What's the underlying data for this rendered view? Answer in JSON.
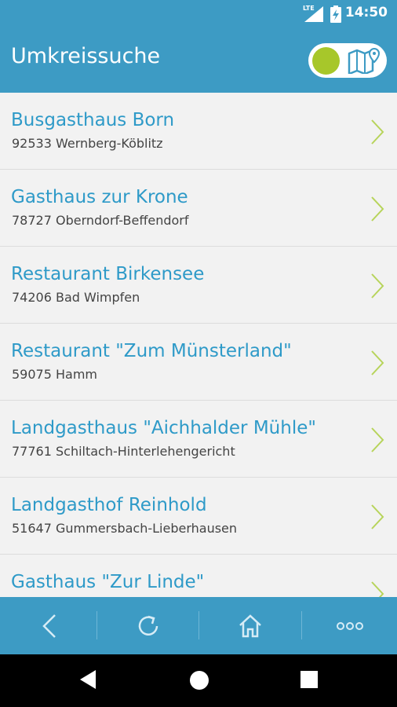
{
  "status_bar": {
    "time": "14:50",
    "network": "LTE"
  },
  "app_bar": {
    "title": "Umkreissuche",
    "view_toggle_icon": "map-icon"
  },
  "results": [
    {
      "name": "Busgasthaus Born",
      "address": "92533 Wernberg-Köblitz"
    },
    {
      "name": "Gasthaus zur Krone",
      "address": "78727 Oberndorf-Beffendorf"
    },
    {
      "name": "Restaurant Birkensee",
      "address": "74206 Bad Wimpfen"
    },
    {
      "name": "Restaurant \"Zum Münsterland\"",
      "address": "59075 Hamm"
    },
    {
      "name": "Landgasthaus \"Aichhalder Mühle\"",
      "address": "77761 Schiltach-Hinterlehengericht"
    },
    {
      "name": "Landgasthof Reinhold",
      "address": "51647 Gummersbach-Lieberhausen"
    },
    {
      "name": "Gasthaus \"Zur Linde\"",
      "address": ""
    }
  ],
  "bottom_bar": {
    "icons": [
      "back-icon",
      "refresh-icon",
      "home-icon",
      "more-icon"
    ]
  },
  "colors": {
    "primary": "#3d9bc4",
    "accent": "#a7c72a",
    "link": "#2e9ac8"
  }
}
